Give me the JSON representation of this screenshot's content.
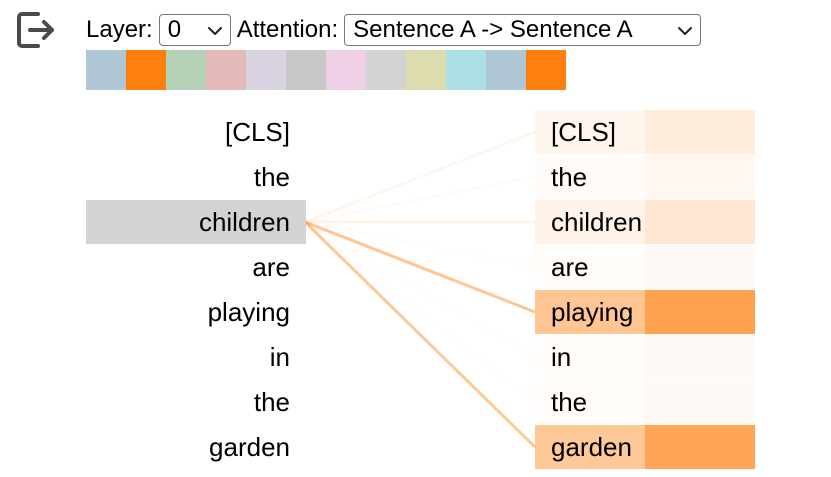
{
  "controls": {
    "layer_label": "Layer:",
    "layer_value": "0",
    "attention_label": "Attention:",
    "attention_value": "Sentence A -> Sentence A"
  },
  "head_colors": [
    "#afc6d5",
    "#ff7f0e",
    "#b5d1b5",
    "#e3b9ba",
    "#d9d2e0",
    "#c7c7c7",
    "#efcfe6",
    "#d3d3d3",
    "#dcdcae",
    "#ade0e4",
    "#afc6d5",
    "#ff7f0e"
  ],
  "attention_color": "#ff7f0e",
  "left_tokens": [
    "[CLS]",
    "the",
    "children",
    "are",
    "playing",
    "in",
    "the",
    "garden"
  ],
  "right_tokens": [
    "[CLS]",
    "the",
    "children",
    "are",
    "playing",
    "in",
    "the",
    "garden"
  ],
  "selected_left_index": 2,
  "attention_weights": [
    0.08,
    0.03,
    0.1,
    0.02,
    0.5,
    0.02,
    0.02,
    0.48
  ],
  "icons": {
    "exit": "exit-icon",
    "dropdown": "chevron-down-icon"
  }
}
